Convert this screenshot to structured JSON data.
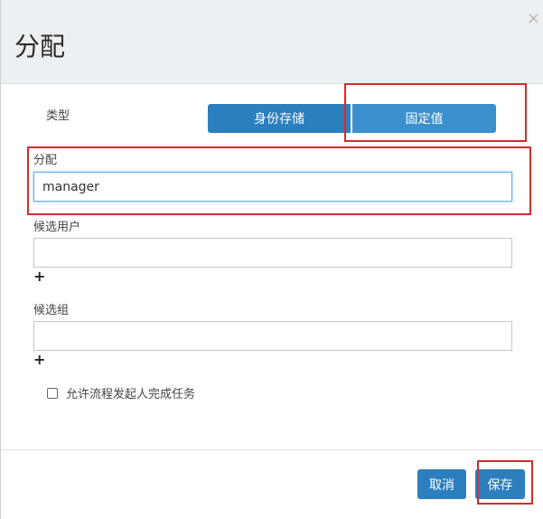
{
  "dialog": {
    "title": "分配",
    "close_label": "×"
  },
  "type_section": {
    "label": "类型",
    "options": [
      "身份存储",
      "固定值"
    ],
    "selected": "固定值"
  },
  "assignment": {
    "label": "分配",
    "value": "manager"
  },
  "candidate_users": {
    "label": "候选用户",
    "value": "",
    "add_label": "+"
  },
  "candidate_groups": {
    "label": "候选组",
    "value": "",
    "add_label": "+"
  },
  "allow_initiator": {
    "label": "允许流程发起人完成任务",
    "checked": false
  },
  "footer": {
    "cancel_label": "取消",
    "save_label": "保存"
  },
  "colors": {
    "primary": "#2c7fbe",
    "highlight": "#d52b2b",
    "header_bg": "#edf0f2"
  }
}
